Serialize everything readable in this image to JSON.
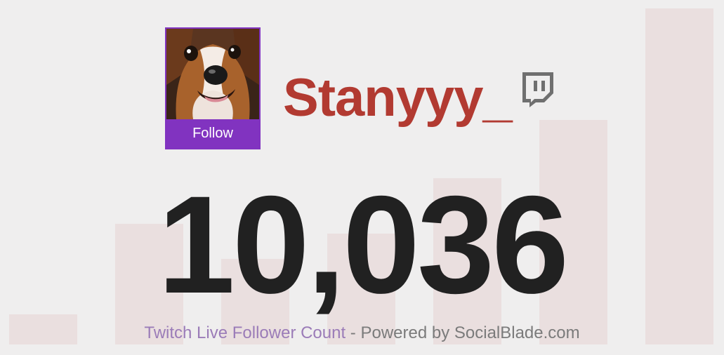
{
  "profile": {
    "channel_name": "Stanyyy_",
    "follow_label": "Follow",
    "platform_icon": "twitch-logo-icon",
    "avatar": "dog-avatar"
  },
  "stats": {
    "follower_count": "10,036"
  },
  "footer": {
    "link_text": "Twitch Live Follower Count",
    "suffix_text": " - Powered by SocialBlade.com"
  },
  "colors": {
    "background": "#efeeee",
    "bars": "#eadfdf",
    "channel_name": "#b23a31",
    "follow_button": "#8133c0",
    "count": "#212121",
    "footer_link": "#9b7cb8",
    "footer_text": "#7b7b7b"
  }
}
